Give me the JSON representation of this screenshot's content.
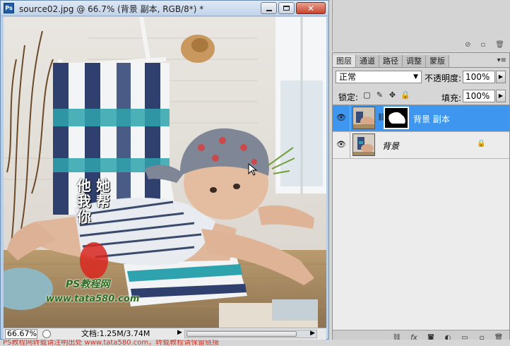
{
  "document": {
    "title": "source02.jpg @ 66.7% (背景 副本, RGB/8*) *",
    "app_badge": "Ps",
    "zoom": "66.67%",
    "doc_info": "文档:1.25M/3.74M",
    "watermark_lines": [
      "他",
      "她",
      "我",
      "帮",
      "你"
    ],
    "watermark_site_title": "PS教程网",
    "watermark_site_url": "www.tata580.com"
  },
  "layers_panel": {
    "tabs": [
      "图层",
      "通道",
      "路径",
      "调整",
      "蒙版"
    ],
    "blend_mode": "正常",
    "opacity_label": "不透明度:",
    "opacity_value": "100%",
    "lock_label": "锁定:",
    "fill_label": "填充:",
    "fill_value": "100%",
    "layers": [
      {
        "name": "背景 副本",
        "selected": true,
        "has_mask": true,
        "visible": true
      },
      {
        "name": "背景",
        "selected": false,
        "has_mask": false,
        "visible": true,
        "locked": true
      }
    ],
    "footer_icons": [
      "link-icon",
      "fx-icon",
      "mask-icon",
      "adjustment-icon",
      "folder-icon",
      "new-layer-icon",
      "trash-icon"
    ]
  },
  "bottom_watermark": "PS教程网转载请注明出处 www.tata580.com，转载教程请保留链接",
  "colors": {
    "selection": "#3e96ee",
    "titlebar": "#c2d4ea",
    "watermark_red": "#c9382a"
  }
}
